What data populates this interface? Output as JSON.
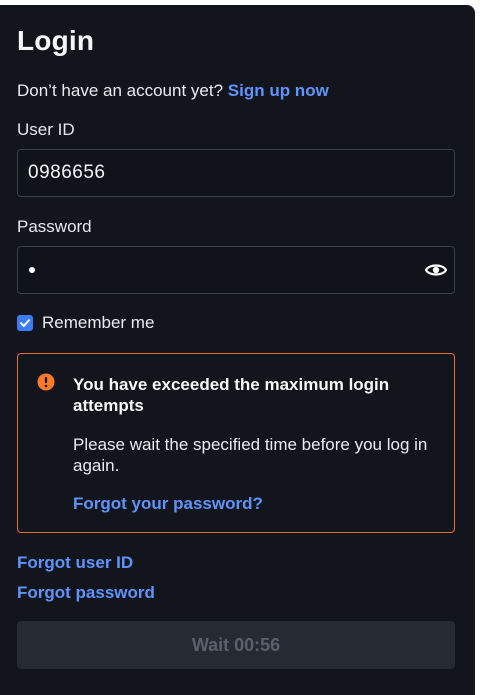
{
  "title": "Login",
  "signup": {
    "prompt": "Don’t have an account yet?",
    "link": "Sign up now"
  },
  "user_id": {
    "label": "User ID",
    "value": "0986656"
  },
  "password": {
    "label": "Password",
    "masked_length": 1,
    "toggle_icon": "eye-icon"
  },
  "remember": {
    "label": "Remember me",
    "checked": true
  },
  "alert": {
    "icon": "exclamation-circle-icon",
    "title": "You have exceeded the maximum login attempts",
    "body": "Please wait the specified time before you log in again.",
    "link": "Forgot your password?",
    "border_color": "#e36d34"
  },
  "links": {
    "forgot_user_id": "Forgot user ID",
    "forgot_password": "Forgot password"
  },
  "wait_button": {
    "label": "Wait 00:56"
  },
  "colors": {
    "background": "#12151b",
    "accent": "#5f93ff",
    "checkbox": "#3b7cf6",
    "warning": "#ff7a29"
  }
}
